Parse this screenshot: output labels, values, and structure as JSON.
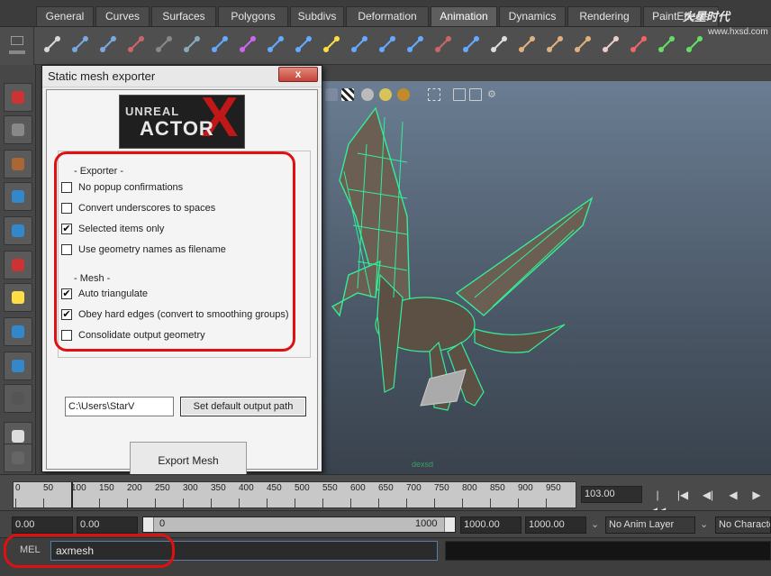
{
  "menu_tabs": [
    "General",
    "Curves",
    "Surfaces",
    "Polygons",
    "Subdivs",
    "Deformation",
    "Animation",
    "Dynamics",
    "Rendering",
    "PaintEffects"
  ],
  "active_tab": "Animation",
  "watermark": {
    "main": "火星时代",
    "url": "www.hxsd.com"
  },
  "dialog": {
    "title": "Static mesh exporter",
    "close_label": "x",
    "logo_text_top": "UNREAL",
    "logo_text_bottom": "ACTOR",
    "logo_mark": "X",
    "exporter_group_label": "- Exporter -",
    "exporter_options": [
      {
        "label": "No popup confirmations",
        "checked": false
      },
      {
        "label": "Convert underscores to spaces",
        "checked": false
      },
      {
        "label": "Selected items only",
        "checked": true
      },
      {
        "label": "Use geometry names as filename",
        "checked": false
      }
    ],
    "mesh_group_label": "- Mesh -",
    "mesh_options": [
      {
        "label": "Auto triangulate",
        "checked": true
      },
      {
        "label": "Obey hard edges (convert to smoothing groups)",
        "checked": true
      },
      {
        "label": "Consolidate output geometry",
        "checked": false
      }
    ],
    "output_path": "C:\\Users\\StarV",
    "set_path_button": "Set default output path",
    "export_button": "Export Mesh"
  },
  "timeline": {
    "ticks": [
      "0",
      "50",
      "100",
      "150",
      "200",
      "250",
      "300",
      "350",
      "400",
      "450",
      "500",
      "550",
      "600",
      "650",
      "700",
      "750",
      "800",
      "850",
      "900",
      "950"
    ],
    "current_frame": "103.00",
    "playback": [
      "|◀◀",
      "|◀",
      "◀|",
      "◀",
      "▶"
    ]
  },
  "range": {
    "start": "0.00",
    "playback_start": "0.00",
    "slider_start": "0",
    "slider_end": "1000",
    "playback_end": "1000.00",
    "end": "1000.00",
    "anim_layer": "No Anim Layer",
    "character": "No Character"
  },
  "command_line": {
    "label": "MEL",
    "value": "axmesh"
  },
  "viewport_watermark": "dexsd",
  "colors": {
    "highlight": "#e01010",
    "wireframe": "#33ee99",
    "logo_red": "#c01818"
  }
}
